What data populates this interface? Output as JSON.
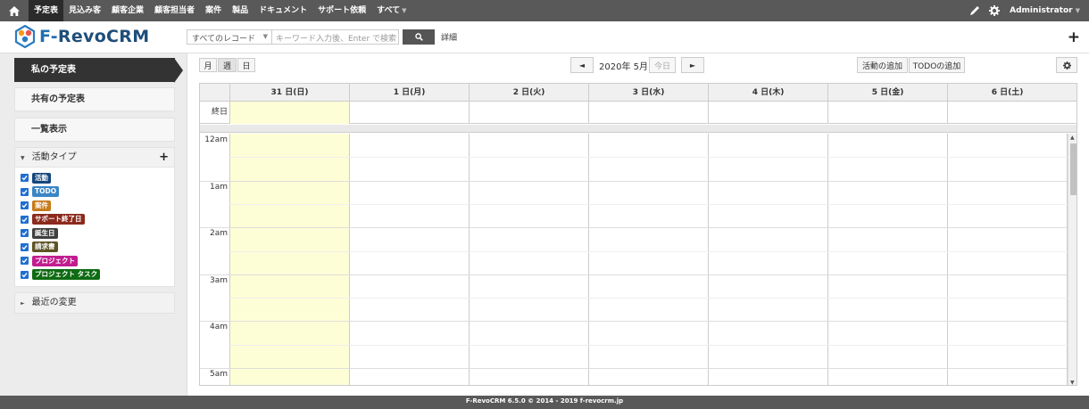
{
  "nav": {
    "items": [
      "予定表",
      "見込み客",
      "顧客企業",
      "顧客担当者",
      "案件",
      "製品",
      "ドキュメント",
      "サポート依頼",
      "すべて"
    ],
    "user": "Administrator"
  },
  "header": {
    "logo_text_f": "F-",
    "logo_text_rest": "RevoCRM",
    "search_scope": "すべてのレコード",
    "search_placeholder": "キーワード入力後、Enter で検索します",
    "advanced_link": "詳細"
  },
  "sidebar": {
    "my_calendar": "私の予定表",
    "shared_calendar": "共有の予定表",
    "list_view": "一覧表示",
    "activity_types_title": "活動タイプ",
    "activity_types": [
      {
        "label": "活動",
        "color": "#14467c"
      },
      {
        "label": "TODO",
        "color": "#3a86c5"
      },
      {
        "label": "案件",
        "color": "#c67a1a"
      },
      {
        "label": "サポート終了日",
        "color": "#8b2a1e"
      },
      {
        "label": "誕生日",
        "color": "#3f3f3f"
      },
      {
        "label": "請求書",
        "color": "#5d5424"
      },
      {
        "label": "プロジェクト",
        "color": "#c21d8f"
      },
      {
        "label": "プロジェクト タスク",
        "color": "#0e6b12"
      }
    ],
    "recent_changes_title": "最近の変更"
  },
  "toolbar": {
    "view_month": "月",
    "view_week": "週",
    "view_day": "日",
    "prev": "◄",
    "next": "►",
    "date_label": "2020年 5月",
    "today": "今日",
    "add_activity": "活動の追加",
    "add_todo": "TODOの追加"
  },
  "calendar": {
    "days": [
      "31 日(日)",
      "1 日(月)",
      "2 日(火)",
      "3 日(水)",
      "4 日(木)",
      "5 日(金)",
      "6 日(土)"
    ],
    "allday_label": "終日",
    "hours": [
      "12am",
      "1am",
      "2am",
      "3am",
      "4am",
      "5am"
    ]
  },
  "footer": {
    "text": "F-RevoCRM 6.5.0 © 2014 - 2019 f-revocrm.jp"
  }
}
